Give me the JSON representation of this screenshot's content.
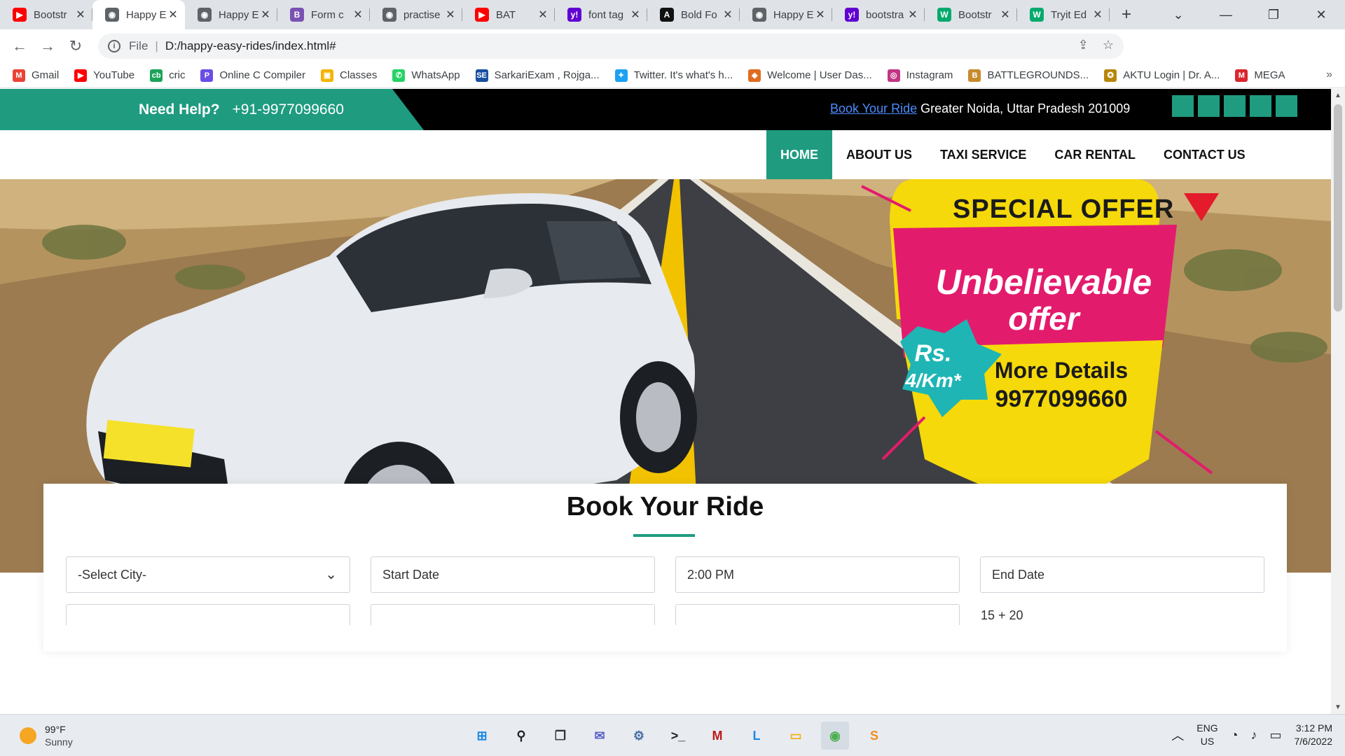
{
  "browser": {
    "tabs": [
      {
        "title": "Bootstr",
        "icon": "youtube-icon",
        "color": "#ff0000",
        "glyph": "▶"
      },
      {
        "title": "Happy E",
        "icon": "globe-icon",
        "color": "#5f6368",
        "glyph": "◉",
        "active": true
      },
      {
        "title": "Happy E",
        "icon": "globe-icon",
        "color": "#5f6368",
        "glyph": "◉"
      },
      {
        "title": "Form c",
        "icon": "bootstrap-icon",
        "color": "#7952b3",
        "glyph": "B"
      },
      {
        "title": "practise",
        "icon": "globe-icon",
        "color": "#5f6368",
        "glyph": "◉"
      },
      {
        "title": "BAT",
        "icon": "youtube-icon",
        "color": "#ff0000",
        "glyph": "▶"
      },
      {
        "title": "font tag",
        "icon": "yahoo-icon",
        "color": "#6001d2",
        "glyph": "y!"
      },
      {
        "title": "Bold Fo",
        "icon": "font-icon",
        "color": "#111111",
        "glyph": "A"
      },
      {
        "title": "Happy E",
        "icon": "globe-icon",
        "color": "#5f6368",
        "glyph": "◉"
      },
      {
        "title": "bootstra",
        "icon": "yahoo-icon",
        "color": "#6001d2",
        "glyph": "y!"
      },
      {
        "title": "Bootstr",
        "icon": "w3schools-icon",
        "color": "#04aa6d",
        "glyph": "W"
      },
      {
        "title": "Tryit Ed",
        "icon": "w3schools-icon",
        "color": "#04aa6d",
        "glyph": "W"
      }
    ],
    "address": {
      "scheme": "File",
      "path": "D:/happy-easy-rides/index.html#"
    },
    "bookmarks": [
      {
        "label": "Gmail",
        "icon": "gmail-icon",
        "color": "#ea4335",
        "glyph": "M"
      },
      {
        "label": "YouTube",
        "icon": "youtube-icon",
        "color": "#ff0000",
        "glyph": "▶"
      },
      {
        "label": "cric",
        "icon": "cricbuzz-icon",
        "color": "#1ca35a",
        "glyph": "cb"
      },
      {
        "label": "Online C Compiler",
        "icon": "programiz-icon",
        "color": "#6b4ce6",
        "glyph": "P"
      },
      {
        "label": "Classes",
        "icon": "classroom-icon",
        "color": "#f4b400",
        "glyph": "▣"
      },
      {
        "label": "WhatsApp",
        "icon": "whatsapp-icon",
        "color": "#25d366",
        "glyph": "✆"
      },
      {
        "label": "SarkariExam , Rojga...",
        "icon": "sarkari-icon",
        "color": "#1a4fa0",
        "glyph": "SE"
      },
      {
        "label": "Twitter. It's what's h...",
        "icon": "twitter-icon",
        "color": "#1da1f2",
        "glyph": "✦"
      },
      {
        "label": "Welcome | User Das...",
        "icon": "dashboard-icon",
        "color": "#e06c1f",
        "glyph": "◆"
      },
      {
        "label": "Instagram",
        "icon": "instagram-icon",
        "color": "#c13584",
        "glyph": "◎"
      },
      {
        "label": "BATTLEGROUNDS...",
        "icon": "battlegrounds-icon",
        "color": "#c78a2c",
        "glyph": "B"
      },
      {
        "label": "AKTU Login | Dr. A...",
        "icon": "aktu-icon",
        "color": "#b8860b",
        "glyph": "✪"
      },
      {
        "label": "MEGA",
        "icon": "mega-icon",
        "color": "#d9272e",
        "glyph": "M"
      }
    ]
  },
  "site": {
    "help_label": "Need Help?",
    "phone": "+91-9977099660",
    "book_link": "Book Your Ride",
    "location": "Greater Noida, Uttar Pradesh 201009",
    "nav": [
      "HOME",
      "ABOUT US",
      "TAXI SERVICE",
      "CAR RENTAL",
      "CONTACT US"
    ],
    "nav_active": "HOME",
    "hero": {
      "badge_top": "SPECIAL OFFER",
      "badge_line1": "Unbelievable",
      "badge_line2": "offer",
      "price_line1": "Rs.",
      "price_line2": "4/Km*",
      "details_line1": "More Details",
      "details_line2": "9977099660"
    },
    "booking": {
      "title": "Book Your Ride",
      "city_select": "-Select City-",
      "start_date": "Start Date",
      "time": "2:00 PM",
      "end_date": "End Date",
      "captcha": "15 + 20"
    },
    "accent_color": "#1f9b80"
  },
  "taskbar": {
    "temperature": "99°F",
    "condition": "Sunny",
    "apps": [
      {
        "icon": "windows-start-icon",
        "color": "#1e88e5",
        "glyph": "⊞"
      },
      {
        "icon": "search-icon",
        "color": "#222222",
        "glyph": "⚲"
      },
      {
        "icon": "task-view-icon",
        "color": "#333333",
        "glyph": "❐"
      },
      {
        "icon": "chat-icon",
        "color": "#5b5fc7",
        "glyph": "✉"
      },
      {
        "icon": "settings-icon",
        "color": "#4a6fa5",
        "glyph": "⚙"
      },
      {
        "icon": "terminal-icon",
        "color": "#222222",
        "glyph": ">_"
      },
      {
        "icon": "mcafee-icon",
        "color": "#c01818",
        "glyph": "M"
      },
      {
        "icon": "l-app-icon",
        "color": "#1e88e5",
        "glyph": "L"
      },
      {
        "icon": "file-explorer-icon",
        "color": "#f2b01e",
        "glyph": "▭"
      },
      {
        "icon": "chrome-icon",
        "color": "#4caf50",
        "glyph": "◉",
        "active": true
      },
      {
        "icon": "sublime-text-icon",
        "color": "#f28c1e",
        "glyph": "S"
      }
    ],
    "language_line1": "ENG",
    "language_line2": "US",
    "time": "3:12 PM",
    "date": "7/6/2022"
  }
}
